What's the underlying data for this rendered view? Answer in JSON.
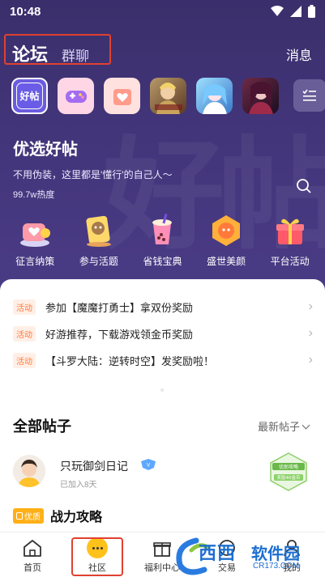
{
  "status": {
    "time": "10:48"
  },
  "header": {
    "tab_active": "论坛",
    "tab_other": "群聊",
    "message": "消息"
  },
  "shortcuts": [
    {
      "name": "好帖",
      "label": "好帖"
    },
    {
      "name": "game-controller"
    },
    {
      "name": "heart-gift"
    },
    {
      "name": "game-avatar-1"
    },
    {
      "name": "game-avatar-2"
    },
    {
      "name": "game-avatar-3"
    }
  ],
  "hero": {
    "title": "优选好帖",
    "subtitle": "不用伪装，这里都是'懂行'的自己人～",
    "heat": "99.7w热度"
  },
  "activities": [
    {
      "label": "征言纳策"
    },
    {
      "label": "参与活题"
    },
    {
      "label": "省钱宝典"
    },
    {
      "label": "盛世美颜"
    },
    {
      "label": "平台活动"
    }
  ],
  "notices": [
    {
      "tag": "活动",
      "text": "参加【魔魔打勇士】拿双份奖励"
    },
    {
      "tag": "活动",
      "text": "好游推荐，下载游戏领金币奖励"
    },
    {
      "tag": "活动",
      "text": "【斗罗大陆：逆转时空】发奖励啦！"
    }
  ],
  "posts_section": {
    "title": "全部帖子",
    "sort": "最新帖子"
  },
  "post": {
    "username": "只玩御剑日记",
    "joined": "已加入8天",
    "badge_top": "优助攻略",
    "badge_bottom": "奖励40金币",
    "quality_tag": "优质",
    "title": "战力攻略"
  },
  "nav": [
    {
      "label": "首页"
    },
    {
      "label": "社区"
    },
    {
      "label": "福利中心"
    },
    {
      "label": "交易"
    },
    {
      "label": "我的"
    }
  ],
  "watermark": {
    "site": "西西",
    "name": "软件园",
    "url": "CR173.COM"
  },
  "colors": {
    "accent": "#4a3b86",
    "highlight": "#e0412f",
    "tag": "#ff7a3c",
    "gold": "#ffb017"
  }
}
